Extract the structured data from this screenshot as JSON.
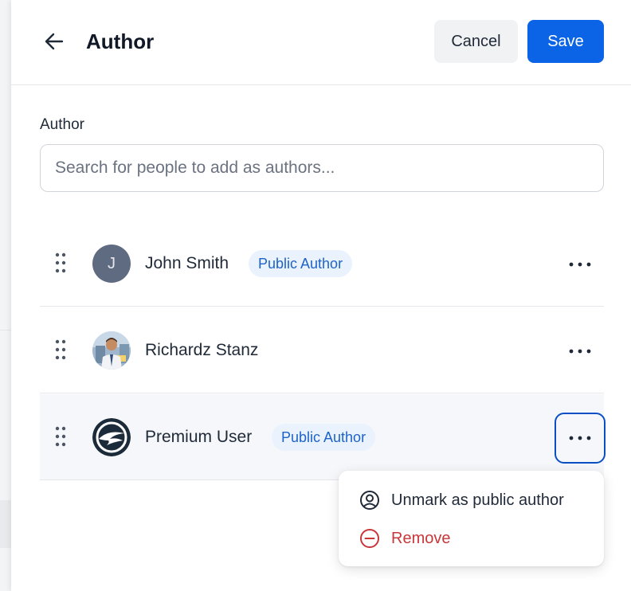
{
  "header": {
    "title": "Author",
    "cancel_label": "Cancel",
    "save_label": "Save"
  },
  "field": {
    "label": "Author",
    "search_placeholder": "Search for people to add as authors..."
  },
  "authors": [
    {
      "name": "John Smith",
      "initial": "J",
      "badge": "Public Author",
      "avatar": "initial-avatar"
    },
    {
      "name": "Richardz Stanz",
      "avatar": "photo-avatar"
    },
    {
      "name": "Premium User",
      "badge": "Public Author",
      "avatar": "logo-avatar"
    }
  ],
  "menu": {
    "items": [
      {
        "label": "Unmark as public author",
        "icon": "user-circle-icon"
      },
      {
        "label": "Remove",
        "icon": "minus-circle-icon"
      }
    ]
  },
  "colors": {
    "accent": "#0b63e5",
    "badge_bg": "#eaf2fd",
    "badge_text": "#1e63c8",
    "danger": "#c8373a"
  }
}
